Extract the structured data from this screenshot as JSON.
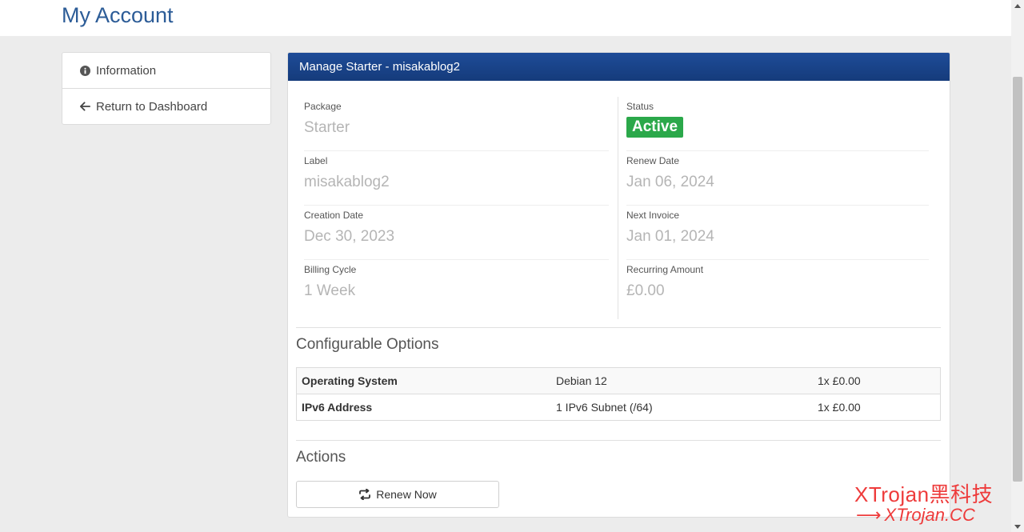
{
  "header": {
    "title": "My Account"
  },
  "sidebar": {
    "items": [
      {
        "label": "Information",
        "icon": "info-circle-icon"
      },
      {
        "label": "Return to Dashboard",
        "icon": "arrow-left-icon"
      }
    ]
  },
  "panel": {
    "title": "Manage Starter - misakablog2",
    "left_fields": [
      {
        "label": "Package",
        "value": "Starter"
      },
      {
        "label": "Label",
        "value": "misakablog2"
      },
      {
        "label": "Creation Date",
        "value": "Dec 30, 2023"
      },
      {
        "label": "Billing Cycle",
        "value": "1 Week"
      }
    ],
    "status": {
      "label": "Status",
      "value": "Active",
      "color": "#2ba84a"
    },
    "right_fields": [
      {
        "label": "Renew Date",
        "value": "Jan 06, 2024"
      },
      {
        "label": "Next Invoice",
        "value": "Jan 01, 2024"
      },
      {
        "label": "Recurring Amount",
        "value": "£0.00"
      }
    ]
  },
  "configurable_options": {
    "title": "Configurable Options",
    "rows": [
      {
        "name": "Operating System",
        "value": "Debian 12",
        "price": "1x £0.00"
      },
      {
        "name": "IPv6 Address",
        "value": "1 IPv6 Subnet (/64)",
        "price": "1x £0.00"
      }
    ]
  },
  "actions": {
    "title": "Actions",
    "renew_label": "Renew Now",
    "renew_icon": "refresh-icon"
  },
  "watermark": {
    "line1": "XTrojan黑科技",
    "line2": "XTrojan.CC"
  },
  "colors": {
    "header_blue": "#1e4c98",
    "title_blue": "#2c5c97",
    "active_green": "#2ba84a"
  }
}
